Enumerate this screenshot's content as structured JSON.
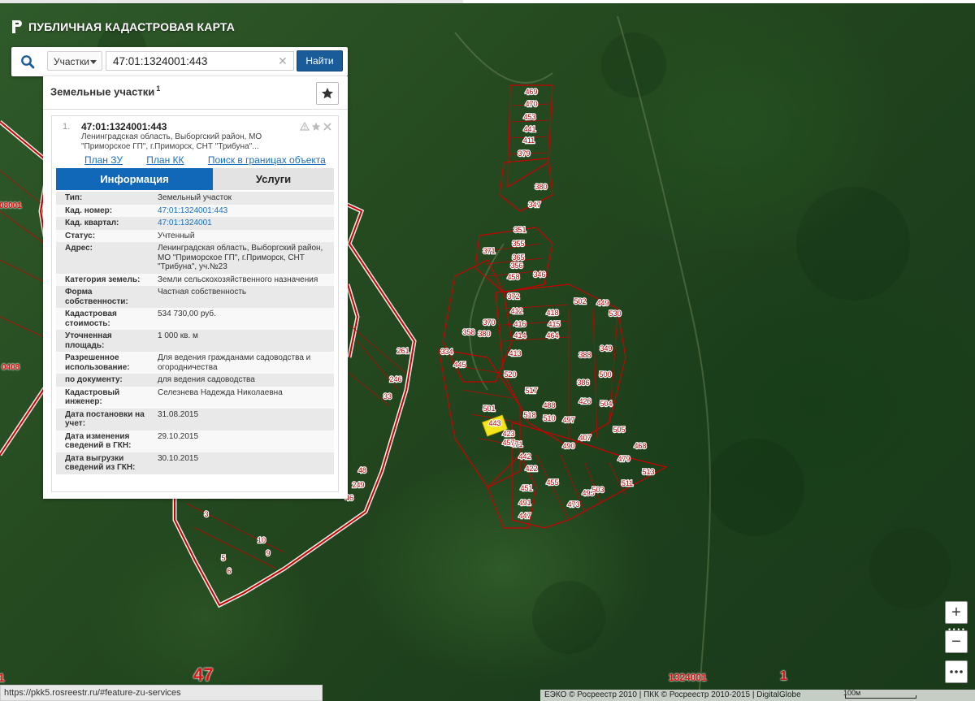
{
  "app": {
    "title": "ПУБЛИЧНАЯ КАДАСТРОВАЯ КАРТА"
  },
  "search": {
    "category": "Участки",
    "query": "47:01:1324001:443",
    "button": "Найти"
  },
  "results": {
    "title": "Земельные участки",
    "count": "1",
    "item": {
      "index": "1.",
      "number": "47:01:1324001:443",
      "address": "Ленинградская область, Выборгский район, МО \"Приморское ГП\", г.Приморск, СНТ \"Трибуна\"...",
      "links": [
        "План ЗУ →",
        "План КК →",
        "Поиск в границах объекта →"
      ]
    },
    "tabs": [
      "Информация",
      "Услуги"
    ],
    "rows": [
      {
        "key": "Тип:",
        "value": "Земельный участок"
      },
      {
        "key": "Кад. номер:",
        "value": "47:01:1324001:443"
      },
      {
        "key": "Кад. квартал:",
        "value": "47:01:1324001"
      },
      {
        "key": "Статус:",
        "value": "Учтенный"
      },
      {
        "key": "Адрес:",
        "value": "Ленинградская область, Выборгский район, МО \"Приморское ГП\", г.Приморск, СНТ \"Трибуна\", уч.№23"
      },
      {
        "key": "Категория земель:",
        "value": "Земли сельскохозяйственного назначения"
      },
      {
        "key": "Форма собственности:",
        "value": "Частная собственность"
      },
      {
        "key": "Кадастровая стоимость:",
        "value": "534 730,00 руб."
      },
      {
        "key": "Уточненная площадь:",
        "value": "1 000 кв. м"
      },
      {
        "key": "Разрешенное использование:",
        "value": "Для ведения гражданами садоводства и огородничества"
      },
      {
        "key": "по документу:",
        "value": "для ведения садоводства"
      },
      {
        "key": "Кадастровый инженер:",
        "value": "Селезнева Надежда Николаевна"
      },
      {
        "key": "Дата постановки на учет:",
        "value": "31.08.2015"
      },
      {
        "key": "Дата изменения сведений в ГКН:",
        "value": "29.10.2015"
      },
      {
        "key": "Дата выгрузки сведений из ГКН:",
        "value": "30.10.2015"
      }
    ]
  },
  "map": {
    "labels": {
      "region": "47",
      "quarter": "1324001",
      "district": "1",
      "edge_left": "1",
      "side1": "08001",
      "side2": "0408"
    },
    "highlight_parcel": "443",
    "parcels": [
      "469",
      "470",
      "453",
      "441",
      "411",
      "379",
      "380",
      "347",
      "351",
      "355",
      "365",
      "371",
      "356",
      "458",
      "346",
      "372",
      "412",
      "418",
      "416",
      "415",
      "414",
      "464",
      "502",
      "449",
      "530",
      "358",
      "370",
      "413",
      "334",
      "445",
      "349",
      "388",
      "386",
      "426",
      "380",
      "500",
      "504",
      "497",
      "505",
      "468",
      "479",
      "511",
      "513",
      "495",
      "473",
      "503",
      "455",
      "491",
      "447",
      "451",
      "422",
      "442",
      "471",
      "423",
      "457",
      "443",
      "501",
      "520",
      "517",
      "518",
      "510",
      "407",
      "488",
      "490",
      "261",
      "246",
      "33",
      "48",
      "249",
      "46",
      "6",
      "5",
      "9",
      "10",
      "3"
    ],
    "zoom_in": "+",
    "zoom_out": "−",
    "scale": "100м"
  },
  "footer": {
    "url": "https://pkk5.rosreestr.ru/#feature-zu-services",
    "attribution": "ЕЭКО © Росреестр 2010 | ПКК © Росреестр 2010-2015 | DigitalGlobe"
  },
  "colors": {
    "accent": "#1268b8",
    "find_button": "#1a5b9a",
    "parcel_border": "#cc0000",
    "highlight": "#f5e51a"
  }
}
